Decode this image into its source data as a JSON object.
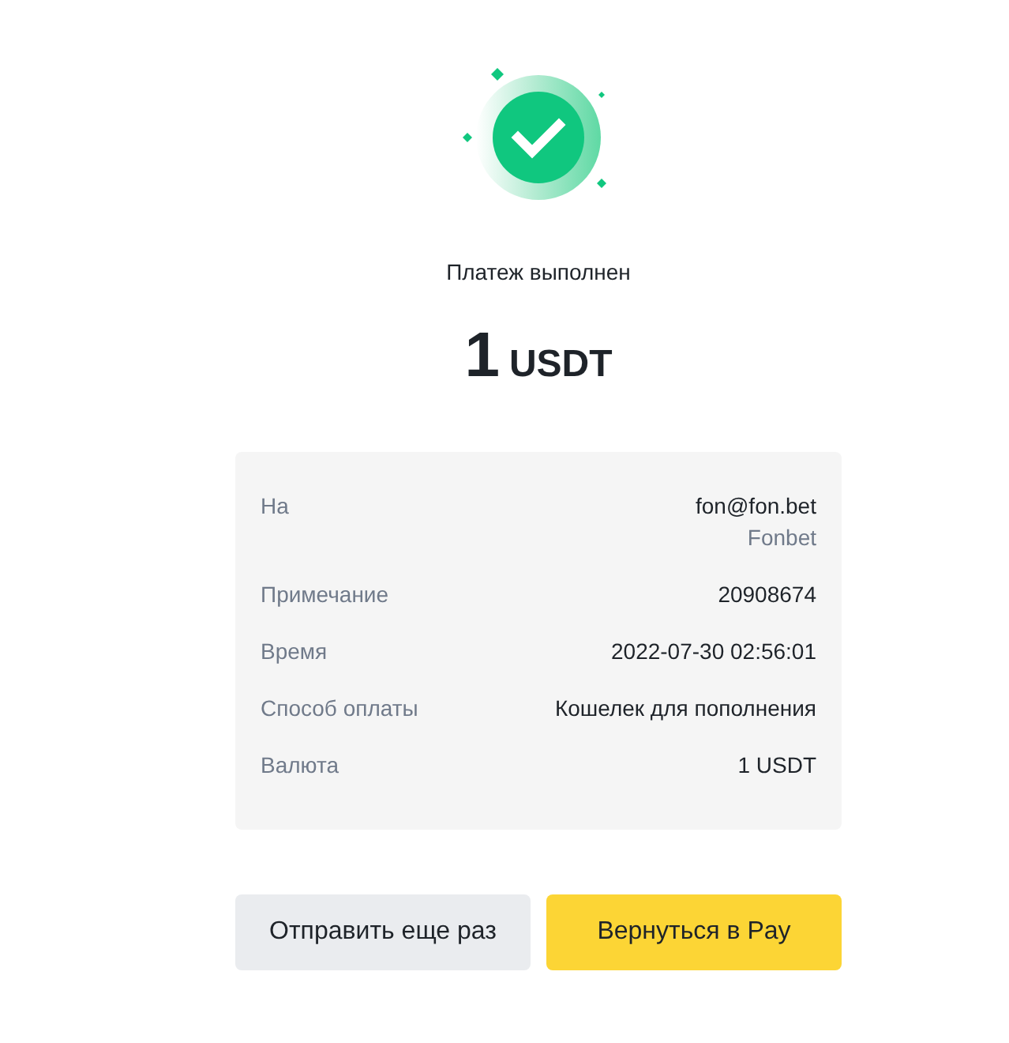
{
  "status": {
    "title": "Платеж выполнен"
  },
  "amount": {
    "value": "1",
    "currency": "USDT"
  },
  "details": [
    {
      "label": "На",
      "value": "fon@fon.bet",
      "subvalue": "Fonbet"
    },
    {
      "label": "Примечание",
      "value": "20908674"
    },
    {
      "label": "Время",
      "value": "2022-07-30 02:56:01"
    },
    {
      "label": "Способ оплаты",
      "value": "Кошелек для пополнения"
    },
    {
      "label": "Валюта",
      "value": "1 USDT"
    }
  ],
  "buttons": [
    {
      "label": "Отправить еще раз",
      "kind": "secondary"
    },
    {
      "label": "Вернуться в Pay",
      "kind": "primary"
    }
  ]
}
